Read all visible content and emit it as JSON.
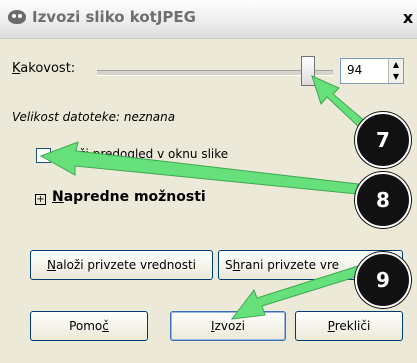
{
  "window": {
    "title": "Izvozi sliko kotJPEG",
    "close_label": "x"
  },
  "quality": {
    "label_underlined": "K",
    "label_rest": "akovost:",
    "value": "94"
  },
  "file_size_text": "Velikost datoteke: neznana",
  "preview_checkbox": {
    "label_start": "P",
    "label_end": "ži predogled v oknu slike",
    "checked": false
  },
  "advanced": {
    "toggle_symbol": "+",
    "label_underlined": "N",
    "label_rest": "apredne možnosti"
  },
  "buttons": {
    "load_defaults_u": "N",
    "load_defaults_rest": "aloži privzete vrednosti",
    "save_defaults_start": "S",
    "save_defaults_u": "h",
    "save_defaults_rest": "rani privzete vre",
    "help_start": "Pomo",
    "help_u": "č",
    "export_u": "I",
    "export_rest": "zvozi",
    "cancel_u": "P",
    "cancel_rest": "rekliči"
  },
  "annotations": {
    "badge_7": "7",
    "badge_8": "8",
    "badge_9": "9",
    "arrow_color": "#66e07a"
  }
}
